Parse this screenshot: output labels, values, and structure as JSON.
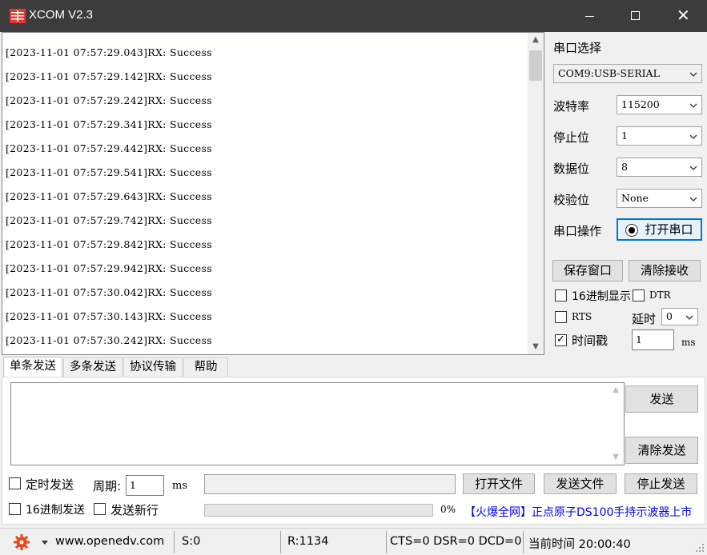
{
  "window": {
    "title": "XCOM V2.3"
  },
  "rx_lines": [
    "[2023-11-01 07:57:29.043]RX: Success",
    "[2023-11-01 07:57:29.142]RX: Success",
    "[2023-11-01 07:57:29.242]RX: Success",
    "[2023-11-01 07:57:29.341]RX: Success",
    "[2023-11-01 07:57:29.442]RX: Success",
    "[2023-11-01 07:57:29.541]RX: Success",
    "[2023-11-01 07:57:29.643]RX: Success",
    "[2023-11-01 07:57:29.742]RX: Success",
    "[2023-11-01 07:57:29.842]RX: Success",
    "[2023-11-01 07:57:29.942]RX: Success",
    "[2023-11-01 07:57:30.042]RX: Success",
    "[2023-11-01 07:57:30.143]RX: Success",
    "[2023-11-01 07:57:30.242]RX: Success"
  ],
  "settings": {
    "port_label": "串口选择",
    "port_value": "COM9:USB-SERIAL",
    "baud_label": "波特率",
    "baud_value": "115200",
    "stop_label": "停止位",
    "stop_value": "1",
    "data_label": "数据位",
    "data_value": "8",
    "parity_label": "校验位",
    "parity_value": "None",
    "op_label": "串口操作",
    "open_port_button": "打开串口",
    "save_window_button": "保存窗口",
    "clear_rx_button": "清除接收",
    "hex_display": {
      "label": "16进制显示",
      "checked": false
    },
    "dtr": {
      "label": "DTR",
      "checked": false
    },
    "rts": {
      "label": "RTS",
      "checked": false
    },
    "delay_label": "延时",
    "delay_value": "0",
    "timestamp": {
      "label": "时间戳",
      "checked": true
    },
    "timestamp_value": "1",
    "timestamp_unit": "ms"
  },
  "tabs": [
    "单条发送",
    "多条发送",
    "协议传输",
    "帮助"
  ],
  "send": {
    "text": "",
    "send_button": "发送",
    "clear_send_button": "清除发送",
    "timed_send": {
      "label": "定时发送",
      "checked": false
    },
    "period_label": "周期:",
    "period_value": "1",
    "period_unit": "ms",
    "file_path": "",
    "open_file_button": "打开文件",
    "send_file_button": "发送文件",
    "stop_send_button": "停止发送",
    "hex_send": {
      "label": "16进制发送",
      "checked": false
    },
    "send_newline": {
      "label": "发送新行",
      "checked": false
    },
    "progress_percent": "0%",
    "promo_text": "【火爆全网】正点原子DS100手持示波器上市"
  },
  "status": {
    "url": "www.openedv.com",
    "sent": "S:0",
    "received": "R:1134",
    "signals": "CTS=0 DSR=0 DCD=0",
    "time": "当前时间 20:00:40"
  }
}
